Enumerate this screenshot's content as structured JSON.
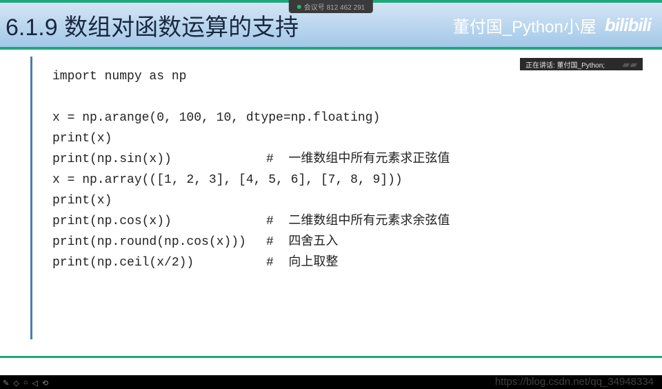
{
  "meeting": {
    "label": "会议号 812 462 291"
  },
  "header": {
    "title": "6.1.9  数组对函数运算的支持",
    "author": "董付国_Python小屋",
    "logo": "bilibili"
  },
  "speaker": {
    "label": "正在讲话: 董付国_Python;"
  },
  "code": {
    "lines": [
      {
        "text": "import numpy as np",
        "comment": ""
      },
      {
        "text": "",
        "comment": ""
      },
      {
        "text": "x = np.arange(0, 100, 10, dtype=np.floating)",
        "comment": ""
      },
      {
        "text": "print(x)",
        "comment": ""
      },
      {
        "text": "print(np.sin(x))",
        "comment": "#  一维数组中所有元素求正弦值"
      },
      {
        "text": "x = np.array(([1, 2, 3], [4, 5, 6], [7, 8, 9]))",
        "comment": ""
      },
      {
        "text": "print(x)",
        "comment": ""
      },
      {
        "text": "print(np.cos(x))",
        "comment": "#  二维数组中所有元素求余弦值"
      },
      {
        "text": "print(np.round(np.cos(x)))",
        "comment": "#  四舍五入"
      },
      {
        "text": "print(np.ceil(x/2))",
        "comment": "#  向上取整"
      }
    ]
  },
  "footer": {
    "icons": [
      "✎",
      "◇",
      "○",
      "◁",
      "⟲"
    ]
  },
  "watermark": "https://blog.csdn.net/qq_34948334"
}
